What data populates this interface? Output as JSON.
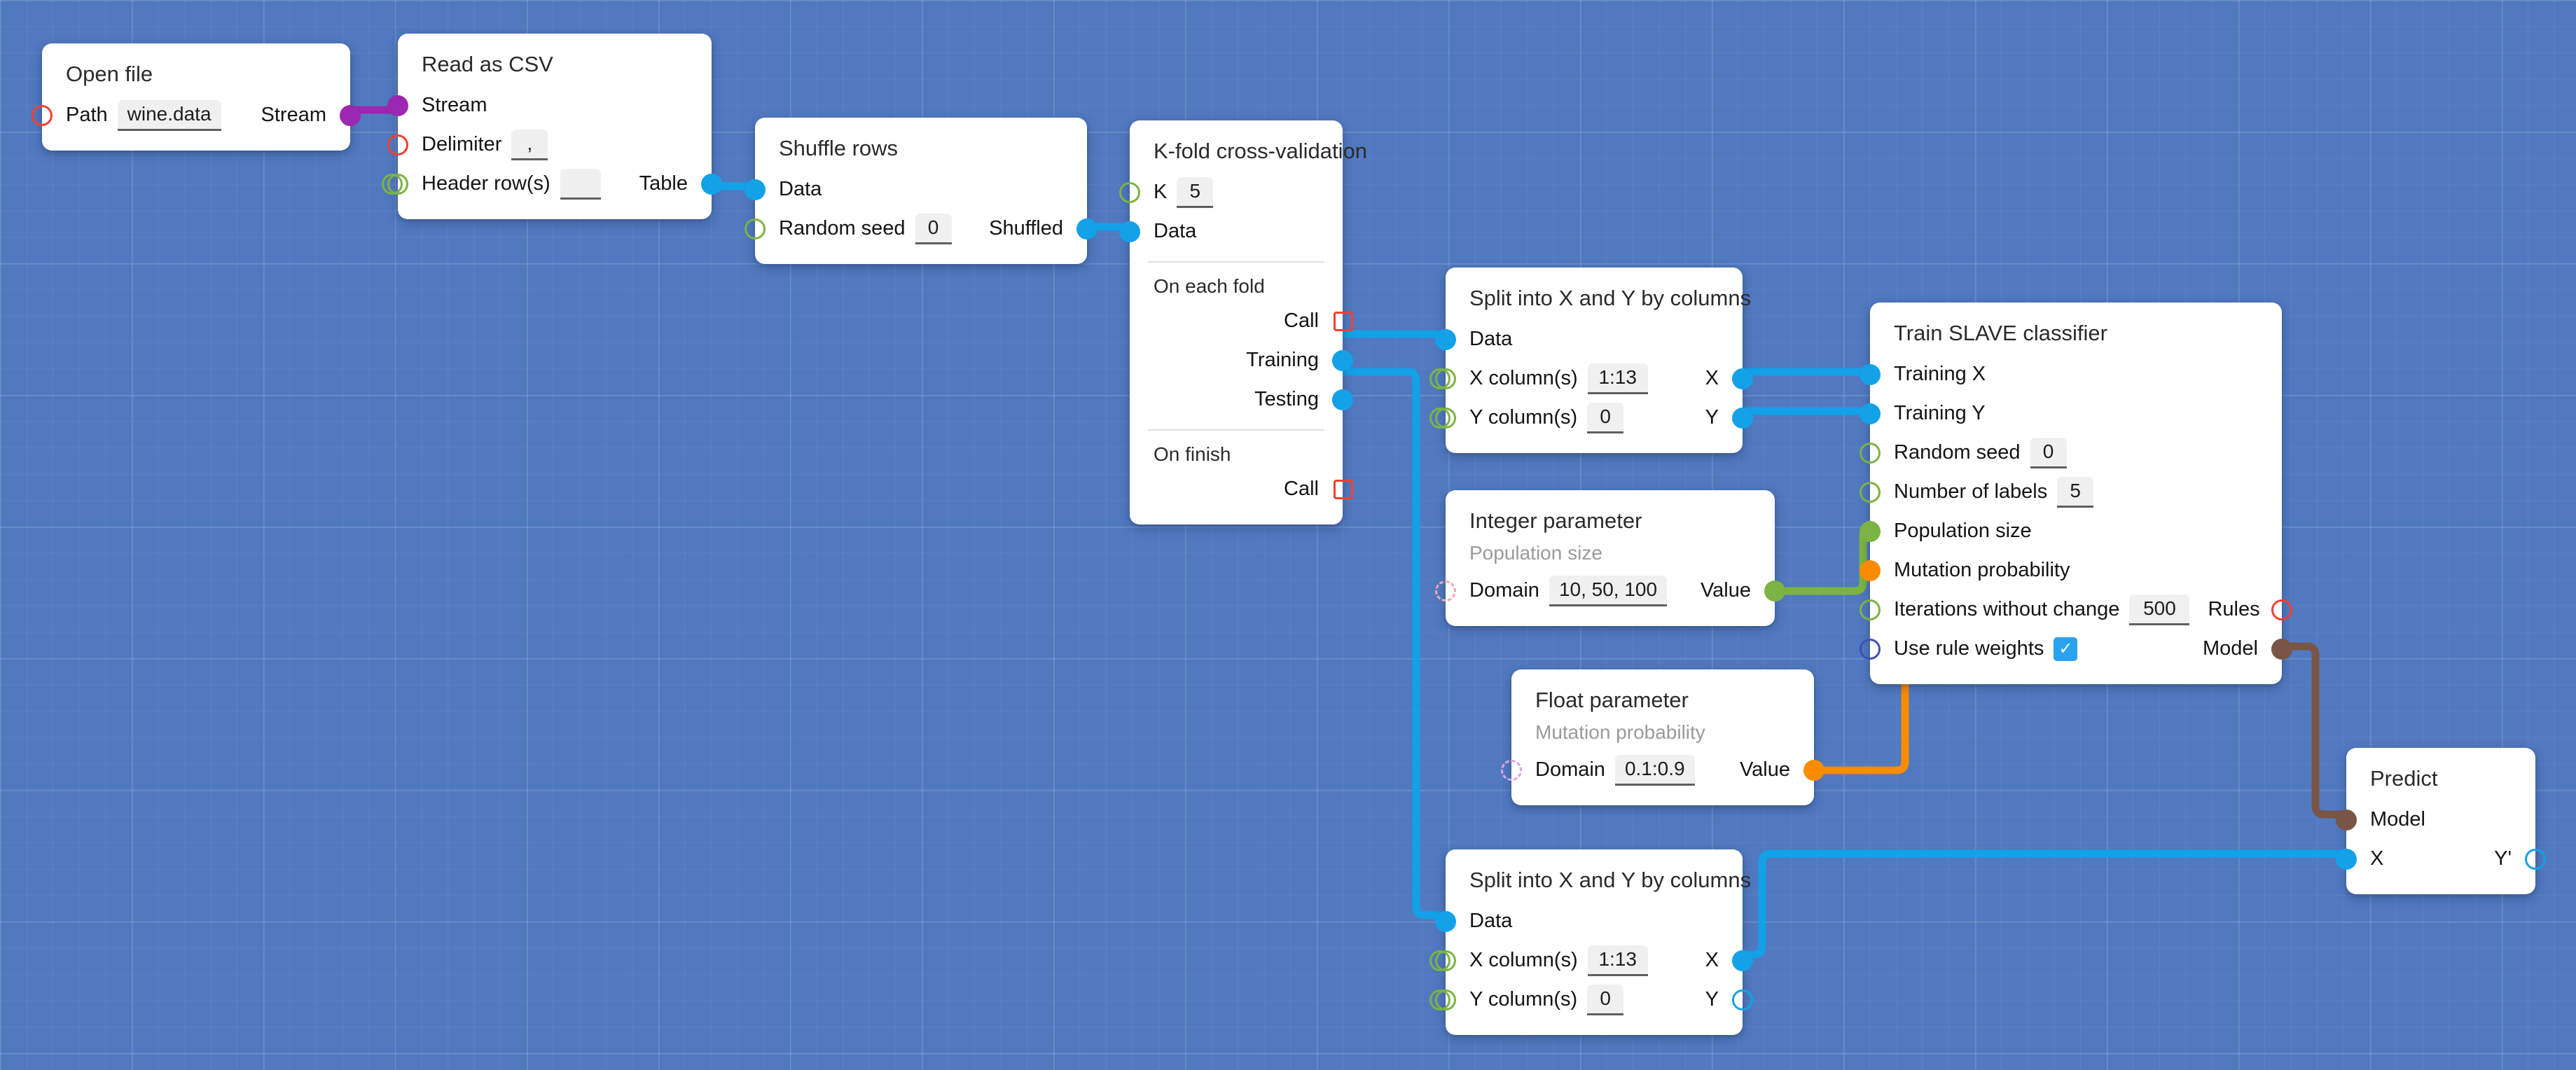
{
  "canvas": {
    "background_color": "#5179c0",
    "grid_color": "#6a8dcb"
  },
  "port_colors": {
    "stream_purple": "#9c27b0",
    "table_blue": "#13a1e8",
    "integer_green": "#7cb342",
    "float_orange": "#fb8c00",
    "model_brown": "#795548",
    "required_red": "#f4402f",
    "bool_navy": "#3f51b5"
  },
  "nodes": [
    {
      "id": "open-file",
      "title": "Open file",
      "rows": [
        {
          "in_label": "Path",
          "in_value": "wine.data",
          "out_label": "Stream"
        }
      ]
    },
    {
      "id": "read-as-csv",
      "title": "Read as CSV",
      "rows": [
        {
          "in_label": "Stream"
        },
        {
          "in_label": "Delimiter",
          "in_value": ","
        },
        {
          "in_label": "Header row(s)",
          "in_value": "",
          "out_label": "Table"
        }
      ]
    },
    {
      "id": "shuffle-rows",
      "title": "Shuffle rows",
      "rows": [
        {
          "in_label": "Data"
        },
        {
          "in_label": "Random seed",
          "in_value": "0",
          "out_label": "Shuffled"
        }
      ]
    },
    {
      "id": "k-fold-cross-validation",
      "title": "K-fold cross-validation",
      "rows": [
        {
          "in_label": "K",
          "in_value": "5"
        },
        {
          "in_label": "Data"
        }
      ],
      "section_each_fold": "On each fold",
      "each_fold_rows": [
        {
          "out_label": "Call"
        },
        {
          "out_label": "Training"
        },
        {
          "out_label": "Testing"
        }
      ],
      "section_finish": "On finish",
      "finish_rows": [
        {
          "out_label": "Call"
        }
      ]
    },
    {
      "id": "split-xy-top",
      "title": "Split into X and Y by columns",
      "rows": [
        {
          "in_label": "Data"
        },
        {
          "in_label": "X column(s)",
          "in_value": "1:13",
          "out_label": "X"
        },
        {
          "in_label": "Y column(s)",
          "in_value": "0",
          "out_label": "Y"
        }
      ]
    },
    {
      "id": "train-slave-classifier",
      "title": "Train SLAVE classifier",
      "rows": [
        {
          "in_label": "Training X"
        },
        {
          "in_label": "Training Y"
        },
        {
          "in_label": "Random seed",
          "in_value": "0"
        },
        {
          "in_label": "Number of labels",
          "in_value": "5"
        },
        {
          "in_label": "Population size"
        },
        {
          "in_label": "Mutation probability"
        },
        {
          "in_label": "Iterations without change",
          "in_value": "500",
          "out_label": "Rules"
        },
        {
          "in_label": "Use rule weights",
          "in_checked": true,
          "out_label": "Model"
        }
      ]
    },
    {
      "id": "integer-parameter",
      "title": "Integer parameter",
      "subtitle": "Population size",
      "rows": [
        {
          "in_label": "Domain",
          "in_value": "10, 50, 100",
          "out_label": "Value"
        }
      ]
    },
    {
      "id": "float-parameter",
      "title": "Float parameter",
      "subtitle": "Mutation probability",
      "rows": [
        {
          "in_label": "Domain",
          "in_value": "0.1:0.9",
          "out_label": "Value"
        }
      ]
    },
    {
      "id": "split-xy-bottom",
      "title": "Split into X and Y by columns",
      "rows": [
        {
          "in_label": "Data"
        },
        {
          "in_label": "X column(s)",
          "in_value": "1:13",
          "out_label": "X"
        },
        {
          "in_label": "Y column(s)",
          "in_value": "0",
          "out_label": "Y"
        }
      ]
    },
    {
      "id": "predict",
      "title": "Predict",
      "rows": [
        {
          "in_label": "Model"
        },
        {
          "in_label": "X",
          "out_label": "Y'"
        }
      ]
    }
  ],
  "edges": [
    {
      "from": "open-file.Stream",
      "to": "read-as-csv.Stream",
      "color": "#9c27b0"
    },
    {
      "from": "read-as-csv.Table",
      "to": "shuffle-rows.Data",
      "color": "#13a1e8"
    },
    {
      "from": "shuffle-rows.Shuffled",
      "to": "k-fold-cross-validation.Data",
      "color": "#13a1e8"
    },
    {
      "from": "k-fold-cross-validation.Training",
      "to": "split-xy-top.Data",
      "color": "#13a1e8"
    },
    {
      "from": "k-fold-cross-validation.Testing",
      "to": "split-xy-bottom.Data",
      "color": "#13a1e8"
    },
    {
      "from": "split-xy-top.X",
      "to": "train-slave-classifier.Training X",
      "color": "#13a1e8"
    },
    {
      "from": "split-xy-top.Y",
      "to": "train-slave-classifier.Training Y",
      "color": "#13a1e8"
    },
    {
      "from": "integer-parameter.Value",
      "to": "train-slave-classifier.Population size",
      "color": "#7cb342"
    },
    {
      "from": "float-parameter.Value",
      "to": "train-slave-classifier.Mutation probability",
      "color": "#fb8c00"
    },
    {
      "from": "train-slave-classifier.Model",
      "to": "predict.Model",
      "color": "#795548"
    },
    {
      "from": "split-xy-bottom.X",
      "to": "predict.X",
      "color": "#13a1e8"
    }
  ]
}
